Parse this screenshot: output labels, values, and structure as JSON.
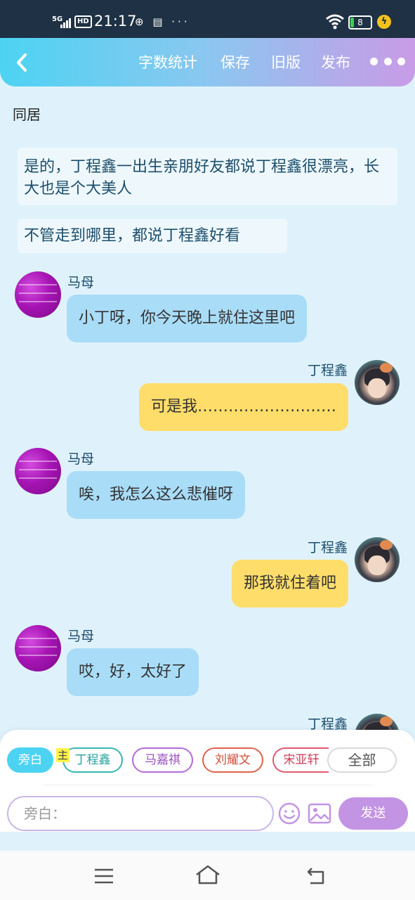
{
  "status_bar": {
    "network": "5G",
    "hd": "HD",
    "time": "21:17",
    "extra_icons": "⊕ ▤ ···",
    "battery": "8"
  },
  "toolbar": {
    "word_count": "字数统计",
    "save": "保存",
    "old_version": "旧版",
    "publish": "发布"
  },
  "scene": {
    "title": "同居",
    "narrations": [
      "是的，丁程鑫一出生亲朋好友都说丁程鑫很漂亮，长大也是个大美人",
      "不管走到哪里，都说丁程鑫好看"
    ]
  },
  "messages": [
    {
      "speaker": "马母",
      "text": "小丁呀，你今天晚上就住这里吧",
      "side": "left"
    },
    {
      "speaker": "丁程鑫",
      "text": "可是我………………………",
      "side": "right"
    },
    {
      "speaker": "马母",
      "text": "唉，我怎么这么悲催呀",
      "side": "left"
    },
    {
      "speaker": "丁程鑫",
      "text": "那我就住着吧",
      "side": "right"
    },
    {
      "speaker": "马母",
      "text": "哎，好，太好了",
      "side": "left"
    },
    {
      "speaker": "丁程鑫",
      "text": "",
      "side": "right"
    }
  ],
  "composer": {
    "chips": {
      "narrator": "旁白",
      "main_badge": "主",
      "ding": "丁程鑫",
      "ma": "马嘉祺",
      "liu": "刘耀文",
      "song": "宋亚轩",
      "all": "全部"
    },
    "input_placeholder": "旁白：",
    "send": "发送"
  },
  "colors": {
    "accent_cyan": "#4dd3f2",
    "accent_purple": "#c393e4",
    "left_bubble": "#a9dcf7",
    "right_bubble": "#ffdd6a",
    "background": "#dff2fb"
  },
  "icons": [
    "back-icon",
    "more-icon",
    "emoji-icon",
    "image-icon",
    "nav-menu-icon",
    "nav-home-icon",
    "nav-back-icon",
    "wifi-icon",
    "battery-icon",
    "charging-icon",
    "signal-icon"
  ]
}
